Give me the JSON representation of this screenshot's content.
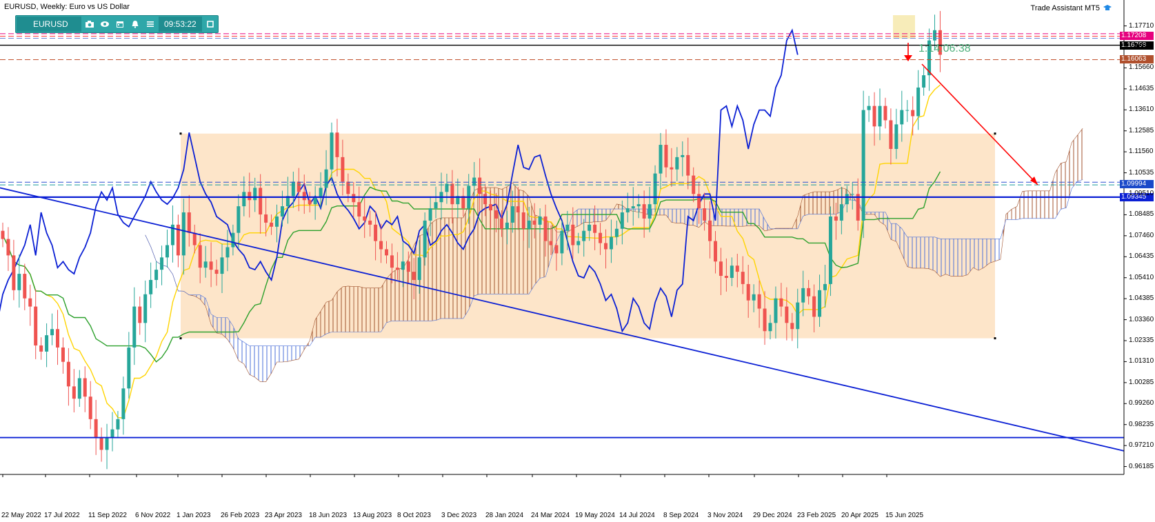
{
  "header": {
    "title": "EURUSD, Weekly: Euro vs US Dollar",
    "assistant": "Trade Assistant MT5"
  },
  "toolbar": {
    "symbol": "EURUSD",
    "time": "09:53:22",
    "icons": [
      "camera-icon",
      "eye-icon",
      "calendar-icon",
      "alarm-icon",
      "menu-icon",
      "window-icon"
    ]
  },
  "timer": "1:14:06:38",
  "colors": {
    "bull": "#26a69a",
    "bear": "#ef5350",
    "zone": "#fde0c0",
    "blue": "#0a1fd4",
    "kijun": "#2ca02c",
    "tenkan": "#ffd400",
    "cloud_up": "#a0522d",
    "cloud_dn": "#4a6fd8",
    "current": "#000000",
    "target_line": "#c0502d",
    "arrow": "#ff0000"
  },
  "price_labels": [
    {
      "value": "1.17208",
      "bg": "#e6007e",
      "fg": "#ffffff"
    },
    {
      "value": "1.16768",
      "bg": "#000000",
      "fg": "#ffffff"
    },
    {
      "value": "1.16063",
      "bg": "#b0502d",
      "fg": "#ffffff"
    },
    {
      "value": "1.09994",
      "bg": "#1a49c9",
      "fg": "#ffffff"
    },
    {
      "value": "1.09345",
      "bg": "#0a1fd4",
      "fg": "#ffffff"
    }
  ],
  "chart_data": {
    "type": "candlestick",
    "timeframe": "Weekly",
    "y_ticks": [
      "1.17710",
      "1.16685",
      "1.15660",
      "1.14635",
      "1.13610",
      "1.12585",
      "1.11560",
      "1.10535",
      "1.09510",
      "1.08485",
      "1.07460",
      "1.06435",
      "1.05410",
      "1.04385",
      "1.03360",
      "1.02335",
      "1.01310",
      "1.00285",
      "0.99260",
      "0.98235",
      "0.97210",
      "0.96185"
    ],
    "ylim": [
      0.958,
      1.181
    ],
    "x_ticks": [
      "22 May 2022",
      "17 Jul 2022",
      "11 Sep 2022",
      "6 Nov 2022",
      "1 Jan 2023",
      "26 Feb 2023",
      "23 Apr 2023",
      "18 Jun 2023",
      "13 Aug 2023",
      "8 Oct 2023",
      "3 Dec 2023",
      "28 Jan 2024",
      "24 Mar 2024",
      "19 May 2024",
      "14 Jul 2024",
      "8 Sep 2024",
      "3 Nov 2024",
      "29 Dec 2024",
      "23 Feb 2025",
      "20 Apr 2025",
      "15 Jun 2025"
    ],
    "candles_close": [
      1.073,
      1.065,
      1.048,
      1.056,
      1.044,
      1.04,
      1.021,
      1.018,
      1.026,
      1.029,
      1.02,
      1.013,
      1.001,
      0.995,
      1.005,
      0.996,
      0.985,
      0.976,
      0.97,
      0.976,
      0.98,
      0.985,
      1.0,
      1.02,
      1.04,
      1.032,
      1.046,
      1.053,
      1.058,
      1.064,
      1.07,
      1.08,
      1.065,
      1.086,
      1.076,
      1.07,
      1.059,
      1.062,
      1.058,
      1.056,
      1.064,
      1.069,
      1.076,
      1.089,
      1.096,
      1.092,
      1.098,
      1.085,
      1.081,
      1.079,
      1.084,
      1.089,
      1.094,
      1.101,
      1.096,
      1.092,
      1.09,
      1.093,
      1.098,
      1.107,
      1.125,
      1.113,
      1.101,
      1.095,
      1.091,
      1.084,
      1.082,
      1.08,
      1.072,
      1.068,
      1.065,
      1.059,
      1.058,
      1.062,
      1.057,
      1.053,
      1.064,
      1.082,
      1.088,
      1.091,
      1.096,
      1.1,
      1.09,
      1.094,
      1.088,
      1.099,
      1.103,
      1.095,
      1.09,
      1.087,
      1.083,
      1.078,
      1.081,
      1.089,
      1.086,
      1.078,
      1.082,
      1.08,
      1.084,
      1.072,
      1.07,
      1.066,
      1.077,
      1.08,
      1.07,
      1.072,
      1.077,
      1.08,
      1.076,
      1.071,
      1.068,
      1.074,
      1.078,
      1.086,
      1.088,
      1.089,
      1.09,
      1.083,
      1.09,
      1.105,
      1.119,
      1.108,
      1.107,
      1.113,
      1.114,
      1.104,
      1.095,
      1.088,
      1.082,
      1.072,
      1.062,
      1.055,
      1.054,
      1.06,
      1.057,
      1.051,
      1.043,
      1.046,
      1.039,
      1.028,
      1.032,
      1.044,
      1.04,
      1.032,
      1.029,
      1.042,
      1.049,
      1.045,
      1.035,
      1.048,
      1.051,
      1.084,
      1.082,
      1.09,
      1.095,
      1.095,
      1.082,
      1.136,
      1.138,
      1.128,
      1.138,
      1.131,
      1.117,
      1.129,
      1.136,
      1.136,
      1.133,
      1.147,
      1.153,
      1.17,
      1.175,
      1.163
    ],
    "series": [
      {
        "values": []
      }
    ],
    "levels": {
      "current": 1.16768,
      "upper_band": 1.17208,
      "target": 1.16063,
      "cloud_level": 1.09994,
      "support": 1.09345,
      "low_line": 0.976
    },
    "zone": {
      "high": 1.1245,
      "low": 1.0245
    },
    "projection_kumo": true,
    "grid": false
  }
}
